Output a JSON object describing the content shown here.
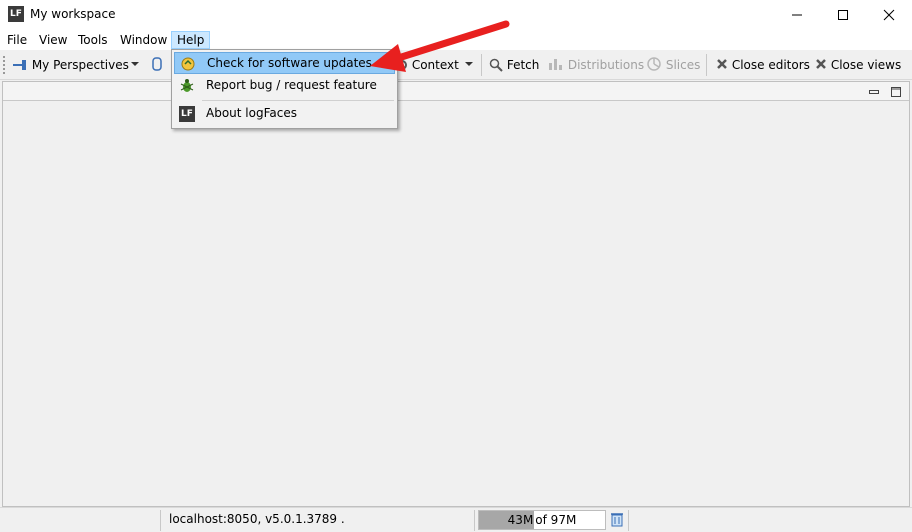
{
  "window": {
    "title": "My workspace",
    "app_icon_text": "LF"
  },
  "menubar": {
    "items": [
      {
        "label": "File"
      },
      {
        "label": "View"
      },
      {
        "label": "Tools"
      },
      {
        "label": "Window"
      },
      {
        "label": "Help"
      }
    ]
  },
  "toolbar": {
    "perspectives_label": "My Perspectives",
    "context_label": "Context",
    "fetch_label": "Fetch",
    "distributions_label": "Distributions",
    "slices_label": "Slices",
    "close_editors_label": "Close editors",
    "close_views_label": "Close views"
  },
  "help_menu": {
    "items": [
      {
        "label": "Check for software updates"
      },
      {
        "label": "Report bug / request feature"
      },
      {
        "label": "About logFaces"
      }
    ]
  },
  "statusbar": {
    "server_info": "localhost:8050, v5.0.1.3789 .",
    "memory_used": "43M",
    "memory_total": "of 97M",
    "memory_fraction": 0.44
  },
  "colors": {
    "highlight": "#91c9f7",
    "active_menu": "#cce8ff",
    "arrow": "#e8201f"
  }
}
